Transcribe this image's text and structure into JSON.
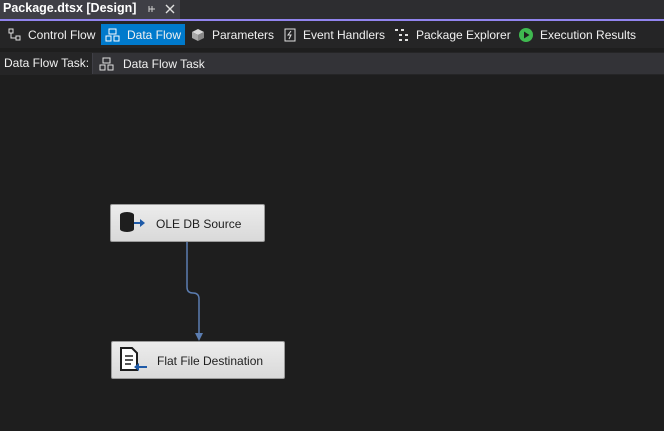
{
  "document_tab": {
    "title": "Package.dtsx [Design]"
  },
  "designer_tabs": [
    {
      "label": "Control Flow",
      "icon": "control-flow-icon",
      "active": false
    },
    {
      "label": "Data Flow",
      "icon": "data-flow-icon",
      "active": true
    },
    {
      "label": "Parameters",
      "icon": "parameters-icon",
      "active": false
    },
    {
      "label": "Event Handlers",
      "icon": "event-handlers-icon",
      "active": false
    },
    {
      "label": "Package Explorer",
      "icon": "package-explorer-icon",
      "active": false
    },
    {
      "label": "Execution Results",
      "icon": "execution-results-icon",
      "active": false
    }
  ],
  "task_bar": {
    "label": "Data Flow Task:",
    "selected_task": "Data Flow Task"
  },
  "components": [
    {
      "label": "OLE DB Source",
      "icon": "ole-db-source-icon"
    },
    {
      "label": "Flat File Destination",
      "icon": "flat-file-destination-icon"
    }
  ],
  "colors": {
    "accent": "#007acc",
    "tab_underline": "#9184ee",
    "canvas": "#1e1e1e",
    "connector": "#5b7db1"
  }
}
